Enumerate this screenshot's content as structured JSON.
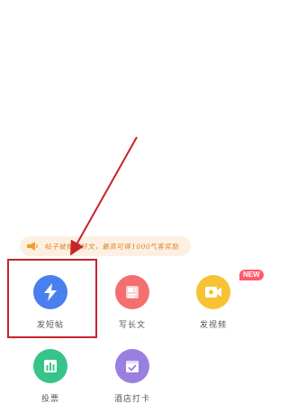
{
  "tip": {
    "text": "帖子被推荐好文，最高可得1000气客奖励",
    "icon": "megaphone-icon"
  },
  "items": [
    {
      "label": "发短帖",
      "icon": "lightning-icon",
      "color": "#4a7ff0"
    },
    {
      "label": "写长文",
      "icon": "article-icon",
      "color": "#f46f6f"
    },
    {
      "label": "发视频",
      "icon": "video-camera-icon",
      "color": "#f7c233",
      "badge": "NEW"
    },
    {
      "label": "投票",
      "icon": "bar-chart-icon",
      "color": "#37c489"
    },
    {
      "label": "酒店打卡",
      "icon": "checkin-icon",
      "color": "#9a7fe0"
    }
  ],
  "annotation": {
    "box_color": "#c8232c",
    "arrow_color": "#c8232c"
  }
}
